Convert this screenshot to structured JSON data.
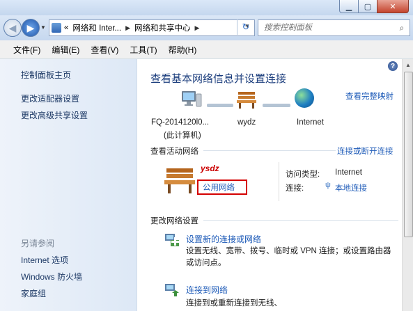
{
  "address": {
    "crumbs": [
      "«",
      "网络和 Inter...",
      "网络和共享中心"
    ],
    "search_placeholder": "搜索控制面板"
  },
  "menu": [
    "文件(F)",
    "编辑(E)",
    "查看(V)",
    "工具(T)",
    "帮助(H)"
  ],
  "sidebar": {
    "links": [
      "控制面板主页",
      "更改适配器设置",
      "更改高级共享设置"
    ],
    "see_also_heading": "另请参阅",
    "see_also": [
      "Internet 选项",
      "Windows 防火墙",
      "家庭组"
    ]
  },
  "content": {
    "heading": "查看基本网络信息并设置连接",
    "full_map_link": "查看完整映射",
    "nodes": [
      {
        "label": "FQ-2014120l0...",
        "sublabel": "(此计算机)"
      },
      {
        "label": "wydz"
      },
      {
        "label": "Internet"
      }
    ],
    "active_section": "查看活动网络",
    "connect_link": "连接或断开连接",
    "network_name": "ysdz",
    "network_type": "公用网络",
    "access_type_label": "访问类型:",
    "access_type_value": "Internet",
    "connection_label": "连接:",
    "connection_value": "本地连接",
    "change_section": "更改网络设置",
    "tasks": [
      {
        "title": "设置新的连接或网络",
        "desc": "设置无线、宽带、拨号、临时或 VPN 连接；或设置路由器或访问点。"
      },
      {
        "title": "连接到网络",
        "desc": "连接到或重新连接到无线、"
      }
    ]
  },
  "colors": {
    "link": "#1e5bb8",
    "heading": "#1c3e7d",
    "highlight_box": "#d40000"
  }
}
